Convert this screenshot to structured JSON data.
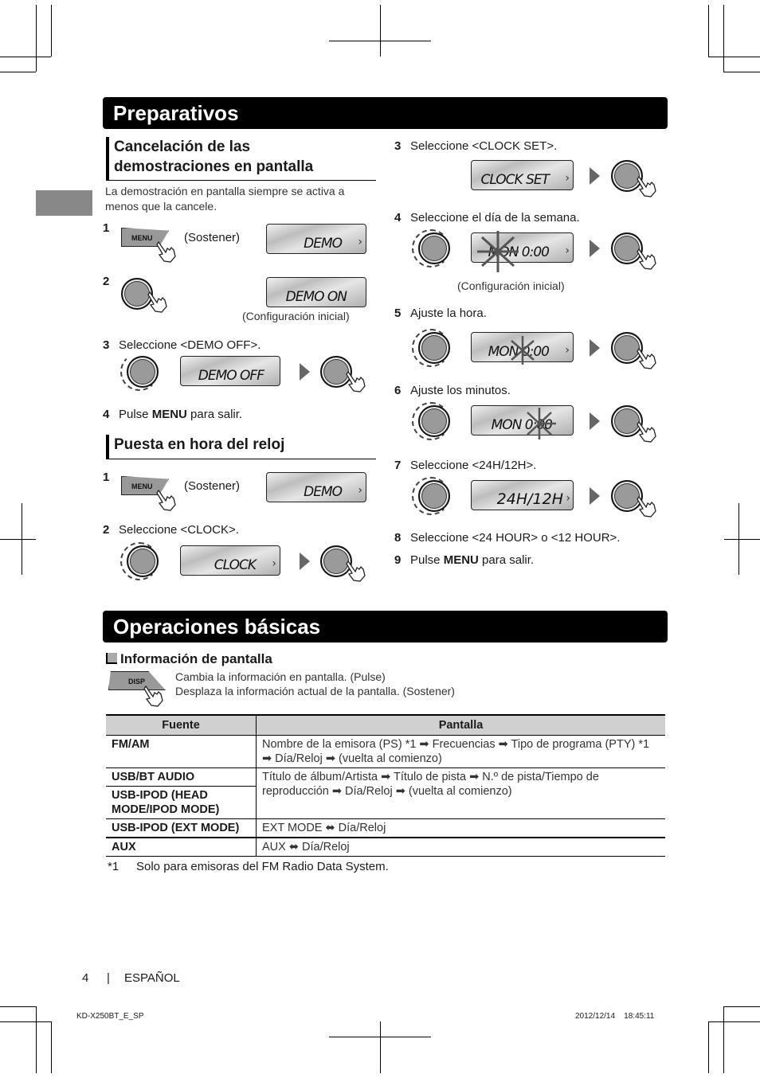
{
  "sections": {
    "preparativos": {
      "title": "Preparativos",
      "demo": {
        "heading": "Cancelación de las demostraciones en pantalla",
        "heading_line1": "Cancelación de las",
        "heading_line2": "demostraciones en pantalla",
        "intro_line1": "La demostración en pantalla siempre se activa a",
        "intro_line2": "menos que la cancele.",
        "steps": [
          {
            "num": "1",
            "button": "MENU",
            "note": "(Sostener)",
            "lcd": "DEMO"
          },
          {
            "num": "2",
            "lcd": "DEMO ON",
            "caption": "(Configuración inicial)"
          },
          {
            "num": "3",
            "text": "Seleccione <DEMO OFF>.",
            "lcd": "DEMO OFF"
          },
          {
            "num": "4",
            "text_pre": "Pulse ",
            "text_bold": "MENU",
            "text_post": " para salir."
          }
        ]
      },
      "clock": {
        "heading": "Puesta en hora del reloj",
        "steps": [
          {
            "num": "1",
            "button": "MENU",
            "note": "(Sostener)",
            "lcd": "DEMO"
          },
          {
            "num": "2",
            "text": "Seleccione <CLOCK>.",
            "lcd": "CLOCK"
          },
          {
            "num": "3",
            "text": "Seleccione <CLOCK SET>.",
            "lcd": "CLOCK SET"
          },
          {
            "num": "4",
            "text": "Seleccione el día de la semana.",
            "lcd": "MON 0:00",
            "caption": "(Configuración inicial)"
          },
          {
            "num": "5",
            "text": "Ajuste la hora.",
            "lcd": "MON 0:00"
          },
          {
            "num": "6",
            "text": "Ajuste los minutos.",
            "lcd": "MON 0:00"
          },
          {
            "num": "7",
            "text": "Seleccione <24H/12H>.",
            "lcd": "24H/12H"
          },
          {
            "num": "8",
            "text": "Seleccione <24 HOUR> o <12 HOUR>."
          },
          {
            "num": "9",
            "text_pre": "Pulse ",
            "text_bold": "MENU",
            "text_post": " para salir."
          }
        ]
      }
    },
    "operaciones": {
      "title": "Operaciones básicas",
      "info": {
        "heading": "Información de pantalla",
        "button": "DISP",
        "desc_line1": "Cambia la información en pantalla. (Pulse)",
        "desc_line2": "Desplaza la información actual de la pantalla. (Sostener)"
      },
      "table": {
        "headers": [
          "Fuente",
          "Pantalla"
        ],
        "rows": [
          {
            "source": "FM/AM",
            "display": "Nombre de la emisora (PS) *1 ➡ Frecuencias ➡ Tipo de programa (PTY) *1 ➡ Día/Reloj ➡ (vuelta al comienzo)"
          },
          {
            "source": "USB/BT AUDIO",
            "display": "Título de álbum/Artista ➡ Título de pista ➡ N.º de pista/Tiempo de reproducción ➡ Día/Reloj ➡ (vuelta al comienzo)"
          },
          {
            "source": "USB-IPOD (HEAD MODE/IPOD MODE)",
            "display": ""
          },
          {
            "source": "USB-IPOD (EXT MODE)",
            "display": "EXT MODE ⬌ Día/Reloj"
          },
          {
            "source": "AUX",
            "display": "AUX ⬌ Día/Reloj"
          }
        ]
      },
      "footnote_mark": "*1",
      "footnote": "Solo para emisoras del FM Radio Data System."
    }
  },
  "footer": {
    "page_number": "4",
    "separator": "|",
    "language": "ESPAÑOL",
    "file_id": "KD-X250BT_E_SP",
    "timestamp": "2012/12/14    18:45:11"
  }
}
